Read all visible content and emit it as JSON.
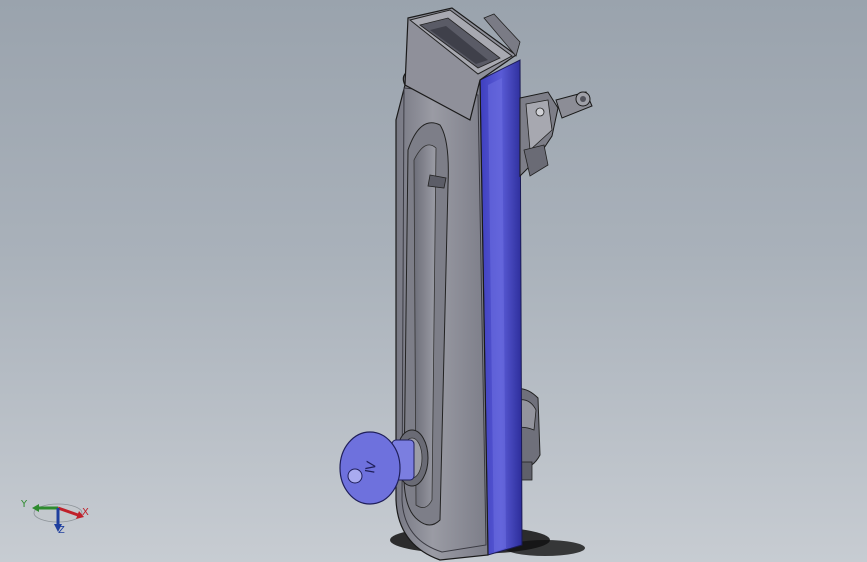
{
  "viewport": {
    "title": "",
    "background_top": "#9aa3ad",
    "background_bottom": "#c7ccd2"
  },
  "model": {
    "name": "",
    "key_engraving": "Ⅳ",
    "body_color": "#8d8e97",
    "edge_color": "#4a4bcc"
  },
  "axis_triad": {
    "x_label": "X",
    "y_label": "Y",
    "z_label": "Z",
    "x_color": "#c0202a",
    "y_color": "#2e8b2e",
    "z_color": "#1f3f9e"
  }
}
